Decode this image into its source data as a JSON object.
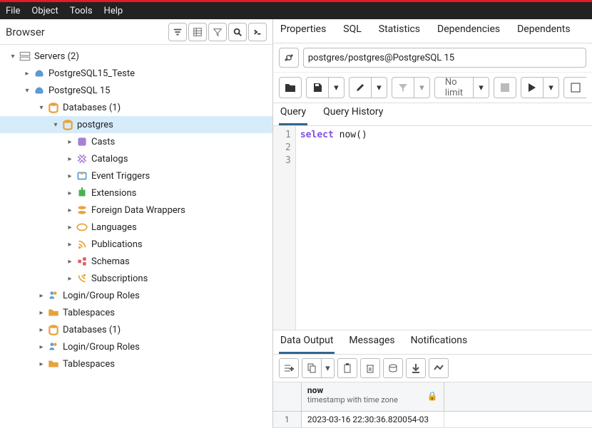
{
  "menubar": {
    "file": "File",
    "object": "Object",
    "tools": "Tools",
    "help": "Help"
  },
  "browser": {
    "title": "Browser"
  },
  "tree": {
    "servers": "Servers (2)",
    "server1": "PostgreSQL15_Teste",
    "server2": "PostgreSQL 15",
    "databases": "Databases (1)",
    "postgres": "postgres",
    "casts": "Casts",
    "catalogs": "Catalogs",
    "event_triggers": "Event Triggers",
    "extensions": "Extensions",
    "fdw": "Foreign Data Wrappers",
    "languages": "Languages",
    "publications": "Publications",
    "schemas": "Schemas",
    "subscriptions": "Subscriptions",
    "login_roles": "Login/Group Roles",
    "tablespaces": "Tablespaces",
    "databases2": "Databases (1)",
    "login_roles2": "Login/Group Roles",
    "tablespaces2": "Tablespaces"
  },
  "tabs": {
    "properties": "Properties",
    "sql": "SQL",
    "statistics": "Statistics",
    "dependencies": "Dependencies",
    "dependents": "Dependents"
  },
  "connection": "postgres/postgres@PostgreSQL 15",
  "nolimit": "No limit",
  "editor_tabs": {
    "query": "Query",
    "history": "Query History"
  },
  "sql": {
    "keyword": "select",
    "rest": " now()"
  },
  "output_tabs": {
    "data": "Data Output",
    "messages": "Messages",
    "notifications": "Notifications"
  },
  "result": {
    "col_name": "now",
    "col_type": "timestamp with time zone",
    "rownum": "1",
    "value": "2023-03-16 22:30:36.820054-03"
  }
}
